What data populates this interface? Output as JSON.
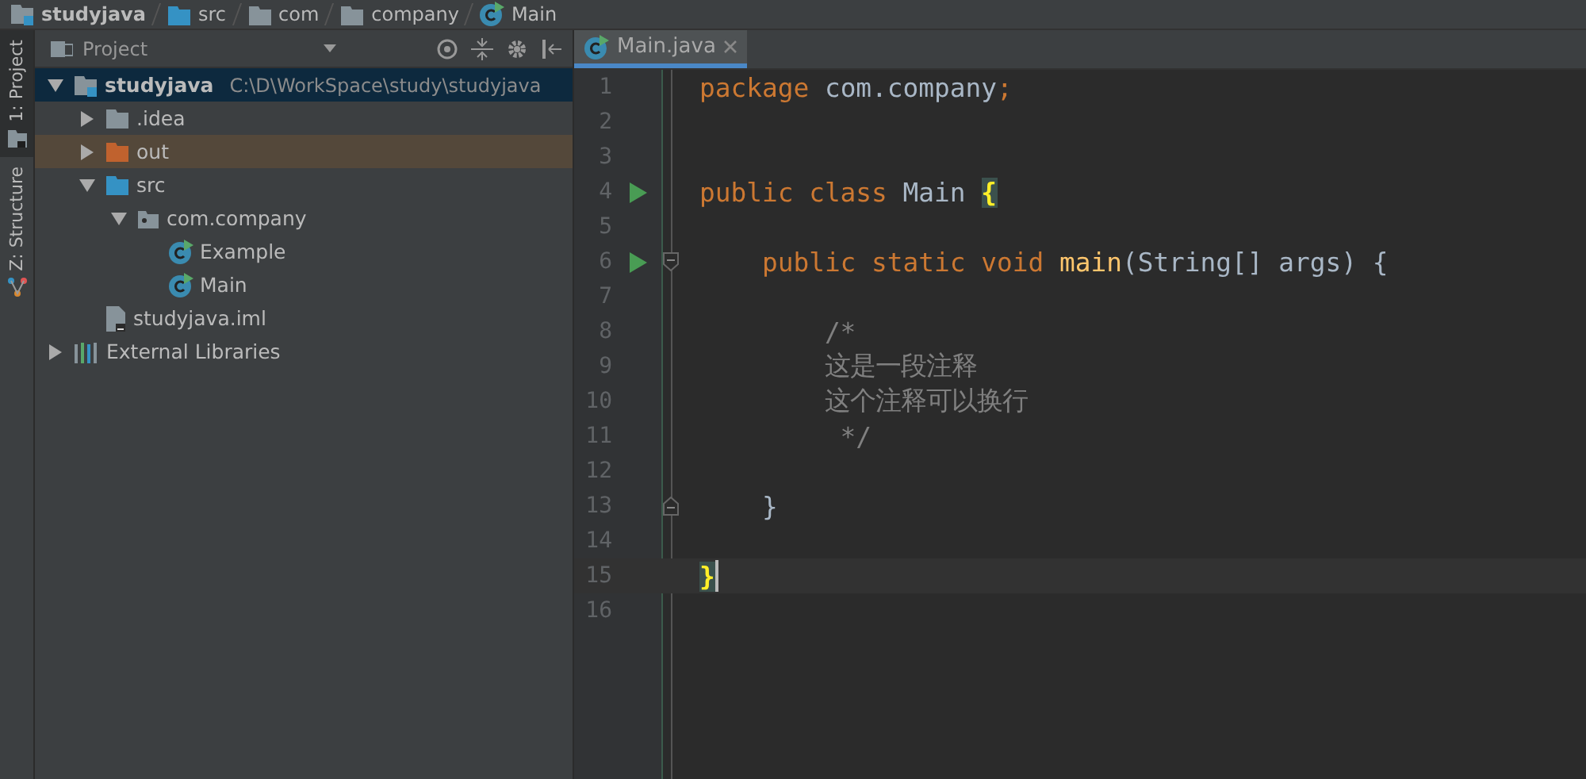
{
  "breadcrumbs": [
    {
      "label": "studyjava",
      "kind": "module"
    },
    {
      "label": "src",
      "kind": "source"
    },
    {
      "label": "com",
      "kind": "folder"
    },
    {
      "label": "company",
      "kind": "folder"
    },
    {
      "label": "Main",
      "kind": "class"
    }
  ],
  "tool_strip": [
    {
      "label": "1: Project",
      "selected": true,
      "kind": "project"
    },
    {
      "label": "Z: Structure",
      "selected": false,
      "kind": "structure"
    }
  ],
  "project_panel": {
    "title": "Project",
    "tree": [
      {
        "label": "studyjava",
        "path": "C:\\D\\WorkSpace\\study\\studyjava",
        "kind": "module",
        "expanded": true,
        "selected": true,
        "highlighted": false,
        "children": [
          {
            "label": ".idea",
            "kind": "folder",
            "expanded": false,
            "selected": false,
            "highlighted": false
          },
          {
            "label": "out",
            "kind": "excluded",
            "expanded": false,
            "selected": false,
            "highlighted": true
          },
          {
            "label": "src",
            "kind": "source",
            "expanded": true,
            "selected": false,
            "highlighted": false,
            "children": [
              {
                "label": "com.company",
                "kind": "package",
                "expanded": true,
                "selected": false,
                "highlighted": false,
                "children": [
                  {
                    "label": "Example",
                    "kind": "class",
                    "selected": false,
                    "highlighted": false
                  },
                  {
                    "label": "Main",
                    "kind": "class",
                    "selected": false,
                    "highlighted": false
                  }
                ]
              }
            ]
          },
          {
            "label": "studyjava.iml",
            "kind": "file",
            "selected": false,
            "highlighted": false
          }
        ]
      },
      {
        "label": "External Libraries",
        "kind": "libraries",
        "expanded": false,
        "selected": false,
        "highlighted": false
      }
    ]
  },
  "editor": {
    "tabs": [
      {
        "label": "Main.java",
        "selected": true
      }
    ],
    "lines": [
      {
        "number": "1",
        "tokens": [
          {
            "text": "package",
            "kind": "keyword"
          },
          {
            "text": " com.company",
            "kind": "plain"
          },
          {
            "text": ";",
            "kind": "keyword"
          }
        ]
      },
      {
        "number": "2"
      },
      {
        "number": "3"
      },
      {
        "number": "4",
        "run": true,
        "tokens": [
          {
            "text": "public class",
            "kind": "keyword"
          },
          {
            "text": " Main ",
            "kind": "plain"
          },
          {
            "text": "{",
            "kind": "match"
          }
        ]
      },
      {
        "number": "5"
      },
      {
        "number": "6",
        "run": true,
        "fold_start": true,
        "tokens": [
          {
            "text": "    public static void ",
            "kind": "keyword"
          },
          {
            "text": "main",
            "kind": "method"
          },
          {
            "text": "(String[] args) {",
            "kind": "plain"
          }
        ]
      },
      {
        "number": "7"
      },
      {
        "number": "8",
        "tokens": [
          {
            "text": "        /*",
            "kind": "comment"
          }
        ]
      },
      {
        "number": "9",
        "tokens": [
          {
            "text": "        这是一段注释",
            "kind": "comment"
          }
        ]
      },
      {
        "number": "10",
        "tokens": [
          {
            "text": "        这个注释可以换行",
            "kind": "comment"
          }
        ]
      },
      {
        "number": "11",
        "tokens": [
          {
            "text": "         */",
            "kind": "comment"
          }
        ]
      },
      {
        "number": "12"
      },
      {
        "number": "13",
        "fold_end": true,
        "tokens": [
          {
            "text": "    }",
            "kind": "plain"
          }
        ]
      },
      {
        "number": "14"
      },
      {
        "number": "15",
        "current": true,
        "tokens": [
          {
            "text": "}",
            "kind": "match"
          }
        ]
      },
      {
        "number": "16"
      }
    ]
  }
}
